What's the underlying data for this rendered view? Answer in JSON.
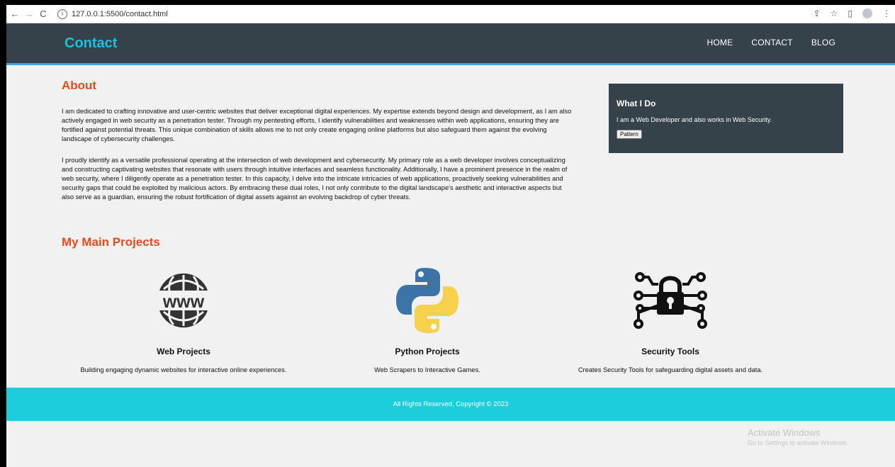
{
  "browser": {
    "url": "127.0.0.1:5500/contact.html"
  },
  "header": {
    "brand": "Contact",
    "nav": [
      "HOME",
      "CONTACT",
      "BLOG"
    ]
  },
  "about": {
    "title": "About",
    "paragraphs": [
      "I am dedicated to crafting innovative and user-centric websites that deliver exceptional digital experiences. My expertise extends beyond design and development, as I am also actively engaged in web security as a penetration tester. Through my pentesting efforts, I identify vulnerabilities and weaknesses within web applications, ensuring they are fortified against potential threats. This unique combination of skills allows me to not only create engaging online platforms but also safeguard them against the evolving landscape of cybersecurity challenges.",
      "I proudly identify as a versatile professional operating at the intersection of web development and cybersecurity. My primary role as a web developer involves conceptualizing and constructing captivating websites that resonate with users through intuitive interfaces and seamless functionality. Additionally, I have a prominent presence in the realm of web security, where I diligently operate as a penetration tester. In this capacity, I delve into the intricate intricacies of web applications, proactively seeking vulnerabilities and security gaps that could be exploited by malicious actors. By embracing these dual roles, I not only contribute to the digital landscape's aesthetic and interactive aspects but also serve as a guardian, ensuring the robust fortification of digital assets against an evolving backdrop of cyber threats."
    ]
  },
  "sidebar": {
    "title": "What I Do",
    "text": "I am a Web Developer and also works in Web Security.",
    "button": "Pattern"
  },
  "projects": {
    "title": "My Main Projects",
    "items": [
      {
        "icon": "www-globe-icon",
        "title": "Web Projects",
        "desc": "Building engaging dynamic websites for interactive online experiences."
      },
      {
        "icon": "python-logo-icon",
        "title": "Python Projects",
        "desc": "Web Scrapers to Interactive Games."
      },
      {
        "icon": "circuit-lock-icon",
        "title": "Security Tools",
        "desc": "Creates Security Tools for safeguarding digital assets and data."
      }
    ]
  },
  "footer": {
    "text": "All Rights Reserved, Copyright © 2023"
  },
  "watermark": {
    "line1": "Activate Windows",
    "line2": "Go to Settings to activate Windows."
  },
  "colors": {
    "header_bg": "#35424a",
    "brand": "#1fc0dc",
    "heading_accent": "#e8491d",
    "footer_bg": "#1ecddc"
  }
}
